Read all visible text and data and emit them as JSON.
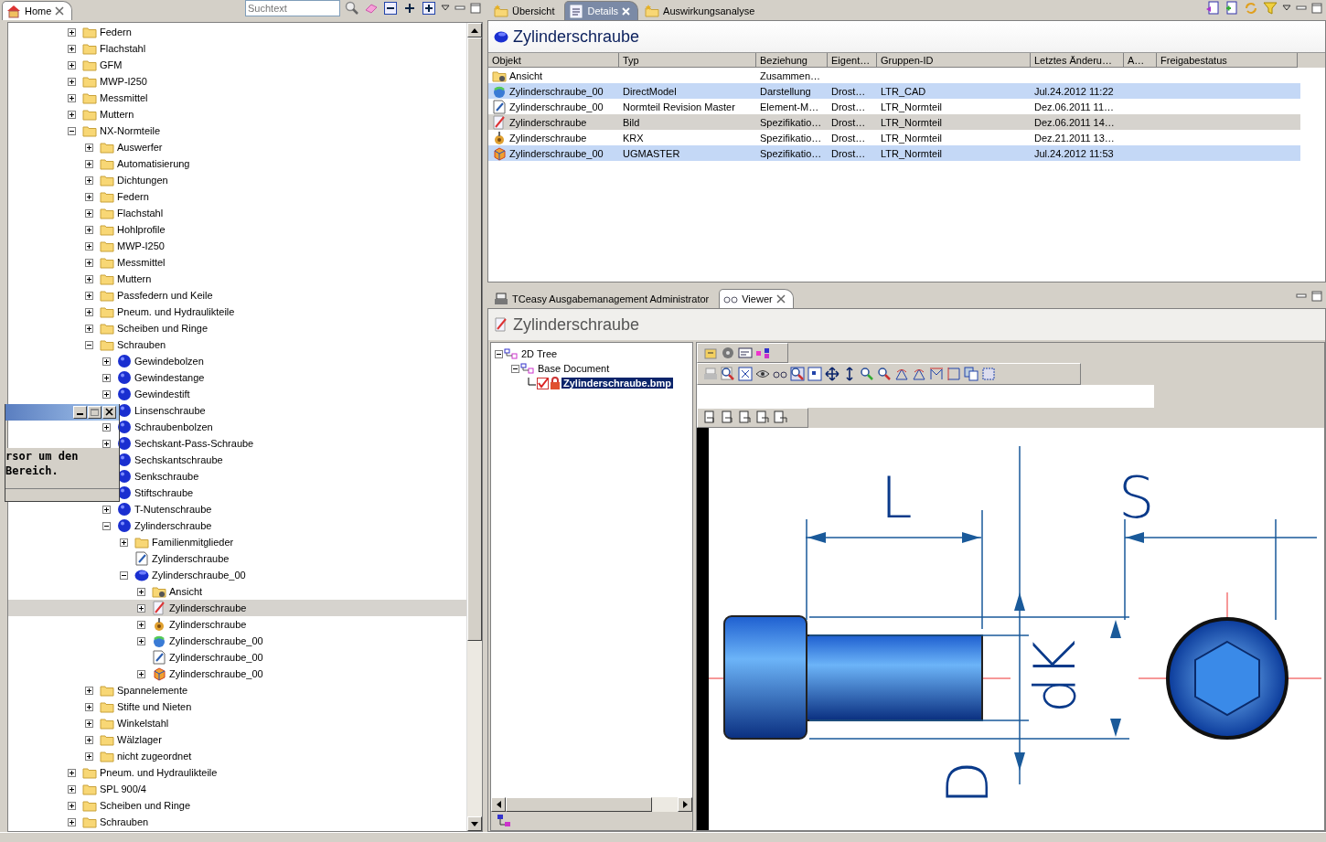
{
  "explorer": {
    "tab": {
      "label": "Home"
    },
    "search": {
      "placeholder": "Suchtext"
    },
    "tree": [
      {
        "label": "Federn",
        "kind": "folder",
        "expanded": false
      },
      {
        "label": "Flachstahl",
        "kind": "folder",
        "expanded": false
      },
      {
        "label": "GFM",
        "kind": "folder",
        "expanded": false
      },
      {
        "label": "MWP-I250",
        "kind": "folder",
        "expanded": false
      },
      {
        "label": "Messmittel",
        "kind": "folder",
        "expanded": false
      },
      {
        "label": "Muttern",
        "kind": "folder",
        "expanded": false
      },
      {
        "label": "NX-Normteile",
        "kind": "folder",
        "expanded": true,
        "children": [
          {
            "label": "Auswerfer",
            "kind": "folder",
            "expanded": false
          },
          {
            "label": "Automatisierung",
            "kind": "folder",
            "expanded": false
          },
          {
            "label": "Dichtungen",
            "kind": "folder",
            "expanded": false
          },
          {
            "label": "Federn",
            "kind": "folder",
            "expanded": false
          },
          {
            "label": "Flachstahl",
            "kind": "folder",
            "expanded": false
          },
          {
            "label": "Hohlprofile",
            "kind": "folder",
            "expanded": false
          },
          {
            "label": "MWP-I250",
            "kind": "folder",
            "expanded": false
          },
          {
            "label": "Messmittel",
            "kind": "folder",
            "expanded": false
          },
          {
            "label": "Muttern",
            "kind": "folder",
            "expanded": false
          },
          {
            "label": "Passfedern und Keile",
            "kind": "folder",
            "expanded": false
          },
          {
            "label": "Pneum. und Hydraulikteile",
            "kind": "folder",
            "expanded": false
          },
          {
            "label": "Scheiben und Ringe",
            "kind": "folder",
            "expanded": false
          },
          {
            "label": "Schrauben",
            "kind": "folder",
            "expanded": true,
            "children": [
              {
                "label": "Gewindebolzen",
                "kind": "part",
                "expanded": false
              },
              {
                "label": "Gewindestange",
                "kind": "part",
                "expanded": false
              },
              {
                "label": "Gewindestift",
                "kind": "part",
                "expanded": false
              },
              {
                "label": "Linsenschraube",
                "kind": "part",
                "expanded": false
              },
              {
                "label": "Schraubenbolzen",
                "kind": "part",
                "expanded": false
              },
              {
                "label": "Sechskant-Pass-Schraube",
                "kind": "part",
                "expanded": false
              },
              {
                "label": "Sechskantschraube",
                "kind": "part",
                "expanded": false
              },
              {
                "label": "Senkschraube",
                "kind": "part",
                "expanded": false
              },
              {
                "label": "Stiftschraube",
                "kind": "part",
                "expanded": false
              },
              {
                "label": "T-Nutenschraube",
                "kind": "part",
                "expanded": false
              },
              {
                "label": "Zylinderschraube",
                "kind": "part",
                "expanded": true,
                "children": [
                  {
                    "label": "Familienmitglieder",
                    "kind": "folder",
                    "expanded": false
                  },
                  {
                    "label": "Zylinderschraube",
                    "kind": "document"
                  },
                  {
                    "label": "Zylinderschraube_00",
                    "kind": "revision",
                    "expanded": true,
                    "children": [
                      {
                        "label": "Ansicht",
                        "kind": "view",
                        "expanded": false
                      },
                      {
                        "label": "Zylinderschraube",
                        "kind": "image",
                        "expanded": false,
                        "selected": true
                      },
                      {
                        "label": "Zylinderschraube",
                        "kind": "krx",
                        "expanded": false
                      },
                      {
                        "label": "Zylinderschraube_00",
                        "kind": "model",
                        "expanded": false
                      },
                      {
                        "label": "Zylinderschraube_00",
                        "kind": "document"
                      },
                      {
                        "label": "Zylinderschraube_00",
                        "kind": "ugmaster",
                        "expanded": false
                      }
                    ]
                  }
                ]
              }
            ]
          },
          {
            "label": "Spannelemente",
            "kind": "folder",
            "expanded": false
          },
          {
            "label": "Stifte und Nieten",
            "kind": "folder",
            "expanded": false
          },
          {
            "label": "Winkelstahl",
            "kind": "folder",
            "expanded": false
          },
          {
            "label": "Wälzlager",
            "kind": "folder",
            "expanded": false
          },
          {
            "label": "nicht zugeordnet",
            "kind": "folder",
            "expanded": false
          }
        ]
      },
      {
        "label": "Pneum. und Hydraulikteile",
        "kind": "folder",
        "expanded": false
      },
      {
        "label": "SPL 900/4",
        "kind": "folder",
        "expanded": false
      },
      {
        "label": "Scheiben und Ringe",
        "kind": "folder",
        "expanded": false
      },
      {
        "label": "Schrauben",
        "kind": "folder",
        "expanded": false
      }
    ]
  },
  "overlay_window": {
    "text": "rsor um den Bereich."
  },
  "details_view": {
    "tabs": [
      {
        "label": "Übersicht",
        "selected": false
      },
      {
        "label": "Details",
        "selected": true
      },
      {
        "label": "Auswirkungsanalyse",
        "selected": false
      }
    ],
    "title": "Zylinderschraube",
    "table": {
      "columns": [
        "Objekt",
        "Typ",
        "Beziehung",
        "Eigent…",
        "Gruppen-ID",
        "Letztes Änderu…",
        "A…",
        "Freigabestatus"
      ],
      "rows": [
        {
          "kind": "view",
          "selected": false,
          "current": false,
          "cells": [
            "Ansicht",
            null,
            "Zusammen…",
            null,
            null,
            null
          ]
        },
        {
          "kind": "model",
          "selected": true,
          "current": false,
          "cells": [
            "Zylinderschraube_00",
            "DirectModel",
            "Darstellung",
            "Drost…",
            "LTR_CAD",
            "Jul.24.2012 11:22"
          ]
        },
        {
          "kind": "document",
          "selected": false,
          "current": false,
          "cells": [
            "Zylinderschraube_00",
            "Normteil Revision Master",
            "Element-M…",
            "Drost…",
            "LTR_Normteil",
            "Dez.06.2011 11…"
          ]
        },
        {
          "kind": "image",
          "selected": false,
          "current": true,
          "cells": [
            "Zylinderschraube",
            "Bild",
            "Spezifikatio…",
            "Drost…",
            "LTR_Normteil",
            "Dez.06.2011 14…"
          ]
        },
        {
          "kind": "krx",
          "selected": false,
          "current": false,
          "cells": [
            "Zylinderschraube",
            "KRX",
            "Spezifikatio…",
            "Drost…",
            "LTR_Normteil",
            "Dez.21.2011 13…"
          ]
        },
        {
          "kind": "ugmaster",
          "selected": true,
          "current": false,
          "cells": [
            "Zylinderschraube_00",
            "UGMASTER",
            "Spezifikatio…",
            "Drost…",
            "LTR_Normteil",
            "Jul.24.2012 11:53"
          ]
        }
      ]
    }
  },
  "viewer_view": {
    "tabs": [
      {
        "label": "TCeasy Ausgabemanagement Administrator",
        "selected": false
      },
      {
        "label": "Viewer",
        "selected": true
      }
    ],
    "title": "Zylinderschraube",
    "tree": [
      {
        "label": "2D Tree",
        "expanded": true,
        "children": [
          {
            "label": "Base Document",
            "expanded": true,
            "children": [
              {
                "label": "Zylinderschraube.bmp",
                "selected": true,
                "checked": true
              }
            ]
          }
        ]
      }
    ],
    "drawing": {
      "labels": [
        "L",
        "S",
        "dK",
        "D"
      ]
    }
  }
}
